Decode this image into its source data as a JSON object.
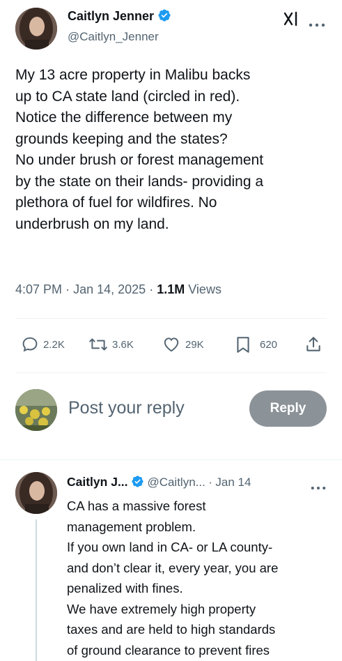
{
  "tweet": {
    "author_name": "Caitlyn Jenner",
    "author_handle": "@Caitlyn_Jenner",
    "text": "My 13 acre property in Malibu backs\nup to CA state land (circled in red).\nNotice the difference between my\ngrounds keeping and the states?\nNo under brush or forest management\nby the state on their lands- providing a\nplethora of fuel for wildfires. No\nunderbrush on my land.",
    "time": "4:07 PM",
    "date": "Jan 14, 2025",
    "views_count": "1.1M",
    "views_label": "Views",
    "separator": "·"
  },
  "actions": {
    "replies": "2.2K",
    "retweets": "3.6K",
    "likes": "29K",
    "bookmarks": "620"
  },
  "composer": {
    "placeholder": "Post your reply",
    "button_label": "Reply"
  },
  "reply": {
    "author_name": "Caitlyn J...",
    "author_handle": "@Caitlyn...",
    "separator": "·",
    "date": "Jan 14",
    "text": "CA has a massive forest\nmanagement problem.\nIf you own land in CA- or LA county-\nand don’t clear it, every year, you are\npenalized with fines.\nWe have extremely high property\ntaxes and are held to high standards\nof ground clearance to prevent fires"
  },
  "icons": {
    "verified_color": "#1d9bf0",
    "grok": "grok-icon",
    "more": "more-icon"
  }
}
